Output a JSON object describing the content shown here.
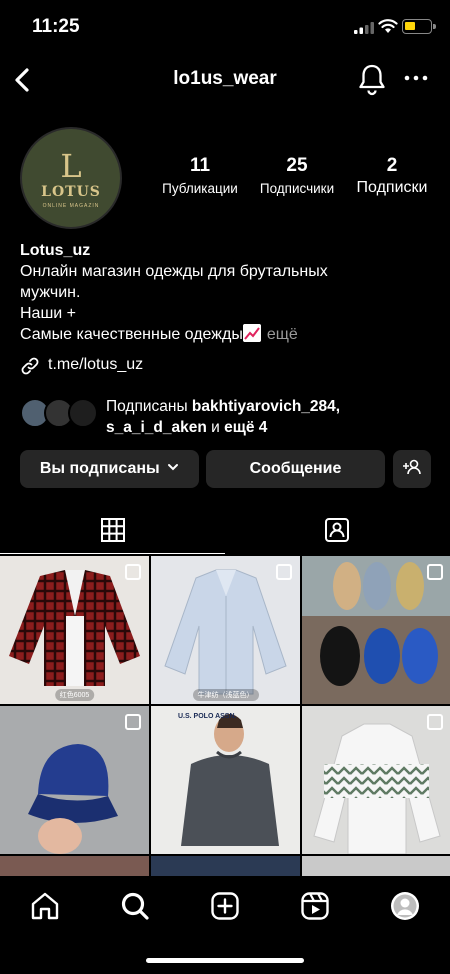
{
  "status_bar": {
    "time": "11:25"
  },
  "header": {
    "username": "lo1us_wear"
  },
  "profile": {
    "avatar_brand": "LOTUS",
    "avatar_letter": "L",
    "avatar_subtext": "ONLINE MAGAZIN",
    "stats": {
      "posts": {
        "value": "11",
        "label": "Публикации"
      },
      "followers": {
        "value": "25",
        "label": "Подписчики"
      },
      "following": {
        "value": "2",
        "label": "Подписки"
      }
    },
    "name": "Lotus_uz",
    "bio_lines": [
      "Онлайн магазин одежды для брутальных",
      "мужчин.",
      "Наши +",
      "Самые качественные одежды"
    ],
    "bio_more": "ещё",
    "link": "t.me/lotus_uz"
  },
  "followed_by": {
    "prefix": "Подписаны",
    "user1": "bakhtiyarovich_284,",
    "user2": "s_a_i_d_aken",
    "middle": "и",
    "suffix": "ещё 4"
  },
  "actions": {
    "following_label": "Вы подписаны",
    "message_label": "Сообщение"
  },
  "grid_posts": [
    {
      "caption": "红色6005",
      "multi": true
    },
    {
      "caption": "牛津纺（浅蓝色）",
      "multi": true
    },
    {
      "caption": "",
      "multi": true
    },
    {
      "caption": "",
      "multi": true
    },
    {
      "caption": "U.S. POLO ASSN.",
      "multi": false
    },
    {
      "caption": "",
      "multi": true
    },
    {
      "caption": "",
      "multi": false
    },
    {
      "caption": "",
      "multi": false
    },
    {
      "caption": "",
      "multi": false
    }
  ],
  "colors": {
    "background": "#000000",
    "button_bg": "#262626",
    "muted_text": "#9a9a9a",
    "battery": "#ffd60a"
  },
  "icons": [
    "back-chevron-icon",
    "bell-icon",
    "more-icon",
    "link-icon",
    "chevron-down-icon",
    "add-user-icon",
    "grid-icon",
    "tagged-icon",
    "home-icon",
    "search-icon",
    "create-icon",
    "reels-icon",
    "profile-icon"
  ]
}
